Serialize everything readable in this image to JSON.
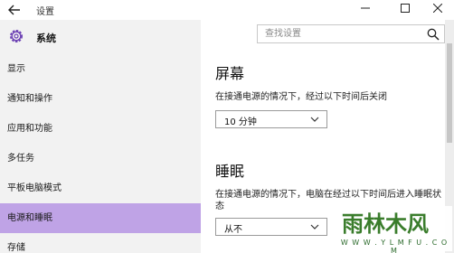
{
  "window": {
    "back_icon": "arrow-left-icon",
    "title": "设置",
    "minimize_icon": "minimize-icon",
    "maximize_icon": "maximize-icon",
    "close_icon": "close-icon"
  },
  "sidebar": {
    "brand_icon": "gear-icon",
    "brand_label": "系统",
    "items": [
      {
        "label": "显示",
        "active": false
      },
      {
        "label": "通知和操作",
        "active": false
      },
      {
        "label": "应用和功能",
        "active": false
      },
      {
        "label": "多任务",
        "active": false
      },
      {
        "label": "平板电脑模式",
        "active": false
      },
      {
        "label": "电源和睡眠",
        "active": true
      },
      {
        "label": "存储",
        "active": false
      }
    ],
    "active_color": "#bfa3e6"
  },
  "search": {
    "placeholder": "查找设置",
    "icon": "search-icon"
  },
  "main": {
    "screen": {
      "title": "屏幕",
      "desc": "在接通电源的情况下，经过以下时间后关闭",
      "selected": "10 分钟"
    },
    "sleep": {
      "title": "睡眠",
      "desc": "在接通电源的情况下，电脑在经过以下时间后进入睡眠状态",
      "selected": "从不"
    }
  },
  "watermark": {
    "brand": "雨林木风",
    "url": "W W W . Y L M F U . C O M"
  }
}
